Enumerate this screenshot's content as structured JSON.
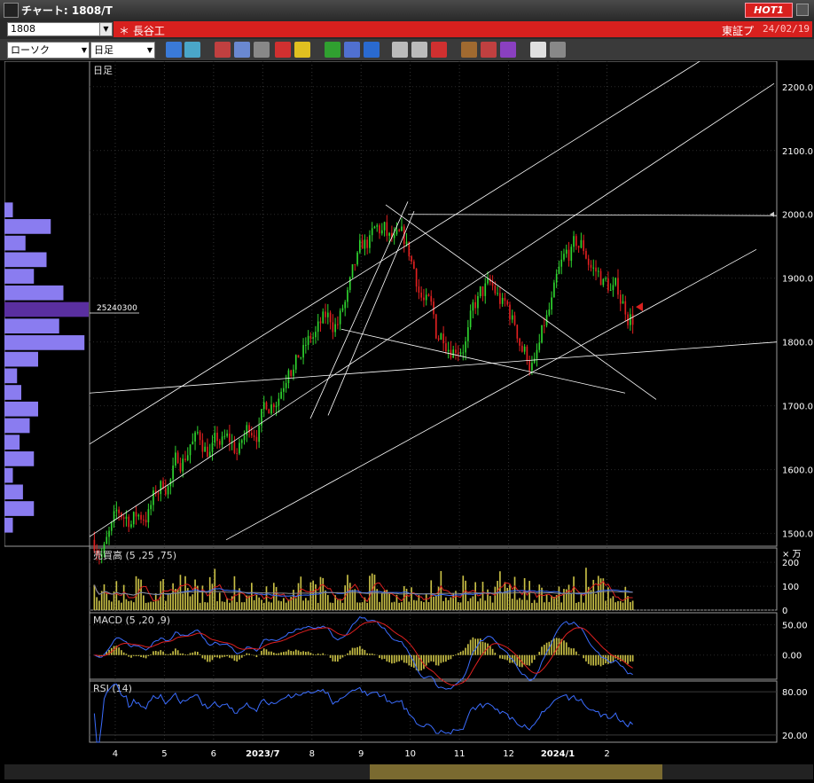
{
  "window": {
    "title": "チャート: 1808/T",
    "hot_badge": "HOT1"
  },
  "symbol": {
    "code": "1808",
    "name": "＊ 長谷工",
    "exchange": "東証プ",
    "date": "24/02/19"
  },
  "toolbar": {
    "chart_type": "ローソク",
    "period": "日足"
  },
  "panel_labels": {
    "main": "日足",
    "volume": "売買高 (5 ,25 ,75)",
    "macd": "MACD (5 ,20 ,9)",
    "rsi": "RSI (14)",
    "volume_unit": "× 万",
    "volume_profile_marker": "25240300"
  },
  "price_axis": [
    "1500.0",
    "1600.0",
    "1700.0",
    "1800.0",
    "1900.0",
    "2000.0",
    "2100.0",
    "2200.0"
  ],
  "volume_axis": [
    "0",
    "100",
    "200"
  ],
  "macd_axis": [
    "0.00",
    "50.00"
  ],
  "rsi_axis": [
    "20.00",
    "80.00"
  ],
  "x_labels": [
    "4",
    "5",
    "6",
    "2023/7",
    "8",
    "9",
    "10",
    "11",
    "12",
    "2024/1",
    "2"
  ],
  "colors": {
    "up": "#2fd52f",
    "down": "#e02020",
    "accent_red": "#d8201e",
    "volume_bar": "#c8bf45",
    "macd_line": "#3b6dff",
    "signal_line": "#e02020",
    "profile": "#8a7cf0",
    "profile_highlight": "#5a2fa0"
  },
  "chart_data": {
    "type": "candlestick",
    "x": [
      "2023-04",
      "2023-05",
      "2023-06",
      "2023-07",
      "2023-08",
      "2023-09",
      "2023-10",
      "2023-11",
      "2023-12",
      "2024-01",
      "2024-02"
    ],
    "close": [
      1530,
      1640,
      1625,
      1770,
      1830,
      1970,
      1820,
      1880,
      1760,
      1950,
      1840
    ],
    "ylim": [
      1480,
      2240
    ],
    "volume_ylim": [
      0,
      260
    ],
    "macd_ylim": [
      -40,
      70
    ],
    "rsi_ylim": [
      10,
      95
    ]
  }
}
